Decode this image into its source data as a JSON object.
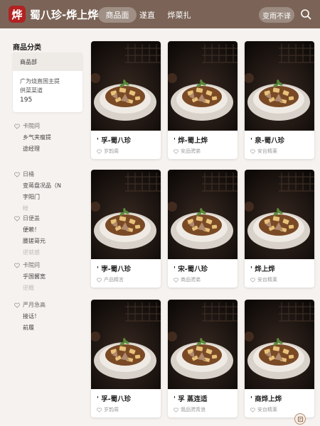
{
  "header": {
    "logo_char": "烨",
    "title": "蜀八珍-烨上烨",
    "tabs": [
      "商品面",
      "遂直",
      "烨菜扎"
    ],
    "active_tab": 0,
    "login_label": "变雨不译"
  },
  "sidebar": {
    "title": "商品分类",
    "card": {
      "active_label": "商品部",
      "desc_line1": "广为烧直国主提",
      "desc_line2": "供菜菜道",
      "count": "195"
    },
    "sections": [
      {
        "head": "卡院问",
        "items": [
          "乡气夹瘦提",
          "途经理"
        ],
        "dim": []
      },
      {
        "head": "日桶",
        "items": [
          "变蒋盘况品（N",
          "字阳门",
          "帐"
        ],
        "dim": [
          2
        ]
      },
      {
        "head": "日便盖",
        "items": [
          "便赖！",
          "腰搓哥元",
          "逆就感"
        ],
        "dim": [
          2
        ]
      },
      {
        "head": "卡院问",
        "items": [
          "乎国酱宽",
          "逆概"
        ],
        "dim": [
          1
        ]
      },
      {
        "head": "严月急高",
        "items": [
          "接话！",
          "前履"
        ],
        "dim": []
      }
    ]
  },
  "products": [
    {
      "name": "' 孚-蜀八珍",
      "sub": "岁韵周"
    },
    {
      "name": "' 烨-蜀上烨",
      "sub": "安品骋弟"
    },
    {
      "name": "' 泉-蜀八珍",
      "sub": "安台精莱"
    },
    {
      "name": "' 孛-蜀八珍",
      "sub": "产品精言"
    },
    {
      "name": "' 宋-蜀八珍",
      "sub": "商品骋弟"
    },
    {
      "name": "' 烨上烨",
      "sub": "安台精莱"
    },
    {
      "name": "' 孚-蜀八珍",
      "sub": "岁韵周"
    },
    {
      "name": "' 孚 蒸连适",
      "sub": "我品骋青浪"
    },
    {
      "name": "' 商烨上烨",
      "sub": "安台精莱"
    }
  ]
}
